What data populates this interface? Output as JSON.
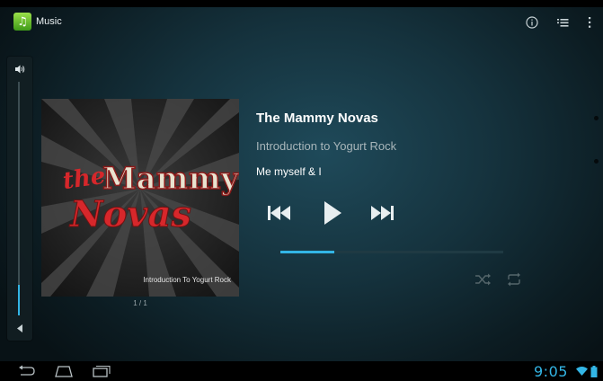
{
  "app": {
    "title": "Music",
    "icon": "music-note-icon"
  },
  "action_bar": {
    "icons": [
      "info-icon",
      "queue-list-icon",
      "overflow-menu-icon"
    ]
  },
  "volume": {
    "level": 0.13,
    "icon": "volume-icon"
  },
  "album_art": {
    "artwork_text": "the Mammy Novas",
    "caption": "Introduction To Yogurt Rock"
  },
  "page_indicator": "1 / 1",
  "track": {
    "artist": "The Mammy Novas",
    "album": "Introduction to Yogurt Rock",
    "song": "Me myself & I"
  },
  "playback": {
    "progress": 0.24,
    "controls": [
      "previous-icon",
      "play-icon",
      "next-icon"
    ],
    "shuffle_icon": "shuffle-icon",
    "repeat_icon": "repeat-icon"
  },
  "system_bar": {
    "time": "9:05",
    "nav_icons": [
      "back-icon",
      "home-icon",
      "recents-icon"
    ],
    "status_icons": [
      "wifi-icon",
      "battery-icon"
    ]
  },
  "colors": {
    "accent": "#33b5e5",
    "background": "#15323d",
    "art_red": "#d6272b"
  }
}
